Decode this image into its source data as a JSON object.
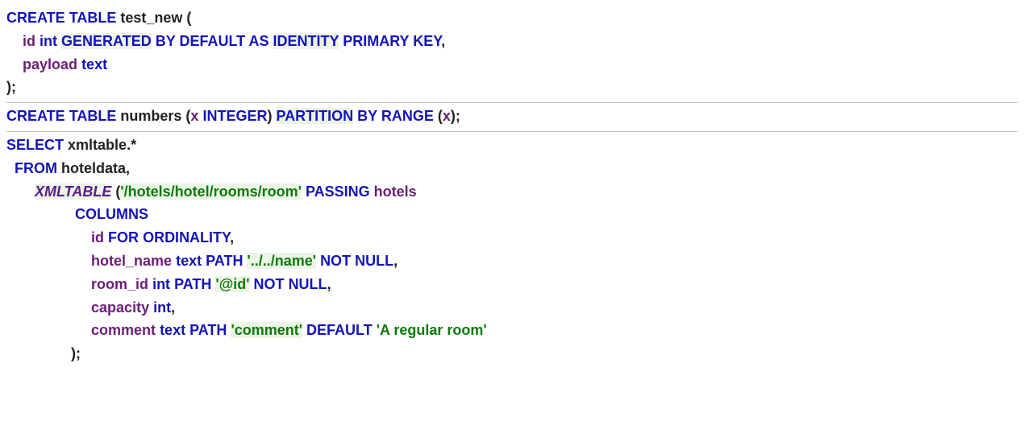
{
  "b1": {
    "l1": {
      "create": "CREATE",
      "table": "TABLE",
      "name": "test_new",
      "op": "("
    },
    "l2": {
      "col": "id",
      "ty": "int",
      "gen": "GENERATED",
      "by": "BY",
      "def": "DEFAULT",
      "as": "AS",
      "ident": "IDENTITY",
      "pk": "PRIMARY",
      "key": "KEY",
      "c": ","
    },
    "l3": {
      "col": "payload",
      "ty": "text"
    },
    "l4": {
      "cp": ");"
    }
  },
  "b2": {
    "create": "CREATE",
    "table": "TABLE",
    "name": "numbers",
    "op": "(",
    "col": "x",
    "ty": "INTEGER",
    "cp": ")",
    "part": "PARTITION",
    "by": "BY",
    "range": "RANGE",
    "op2": "(",
    "col2": "x",
    "cp2": ");"
  },
  "b3": {
    "l1": {
      "sel": "SELECT",
      "x": "xmltable",
      "ds": ".*"
    },
    "l2": {
      "from": "FROM",
      "h": "hoteldata",
      "c": ","
    },
    "l3": {
      "fn": "XMLTABLE",
      "sp": " ",
      "op": "(",
      "str": "'/hotels/hotel/rooms/room'",
      "pass": "PASSING",
      "arg": "hotels"
    },
    "l4": {
      "cols": "COLUMNS"
    },
    "l5": {
      "col": "id",
      "for": "FOR",
      "ord": "ORDINALITY",
      "c": ","
    },
    "l6": {
      "col": "hotel_name",
      "ty": "text",
      "path": "PATH",
      "str": "'../../name'",
      "not": "NOT",
      "nul": "NULL",
      "c": ","
    },
    "l7": {
      "col": "room_id",
      "ty": "int",
      "path": "PATH",
      "str": "'@id'",
      "not": "NOT",
      "nul": "NULL",
      "c": ","
    },
    "l8": {
      "col": "capacity",
      "ty": "int",
      "c": ","
    },
    "l9": {
      "col": "comment",
      "ty": "text",
      "path": "PATH",
      "str": "'comment'",
      "def": "DEFAULT",
      "dstr": "'A regular room'"
    },
    "l10": {
      "cp": ");"
    }
  }
}
